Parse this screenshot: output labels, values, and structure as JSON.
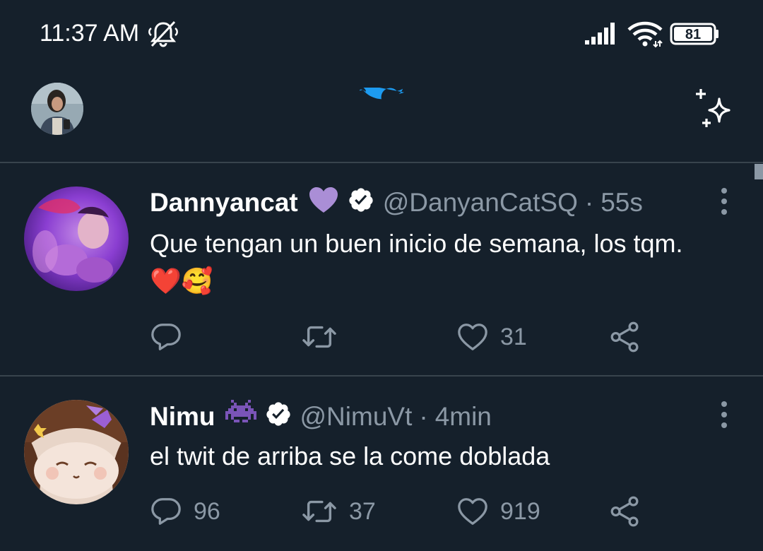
{
  "status_bar": {
    "time": "11:37 AM",
    "battery": "81",
    "icons": [
      "notifications-muted-icon",
      "signal-icon",
      "wifi-icon",
      "battery-icon"
    ]
  },
  "header": {
    "logo": "twitter-bird-icon",
    "left": "profile-avatar",
    "right": "sparkle-icon",
    "accent_color": "#1d9bf0"
  },
  "tweets": [
    {
      "name": "Dannyancat",
      "name_emoji": "💜",
      "verified": true,
      "handle": "@DanyanCatSQ",
      "separator": "·",
      "time": "55s",
      "text": "Que tengan un buen inicio de semana, los tqm. ❤️🥰",
      "reply_count": "",
      "retweet_count": "",
      "like_count": "31"
    },
    {
      "name": "Nimu",
      "name_emoji": "👾",
      "verified": true,
      "handle": "@NimuVt",
      "separator": "·",
      "time": "4min",
      "text": "el twit de arriba se la come doblada",
      "reply_count": "96",
      "retweet_count": "37",
      "like_count": "919"
    }
  ],
  "colors": {
    "background": "#15202b",
    "secondary_text": "#8b98a5",
    "divider": "#38444d"
  }
}
